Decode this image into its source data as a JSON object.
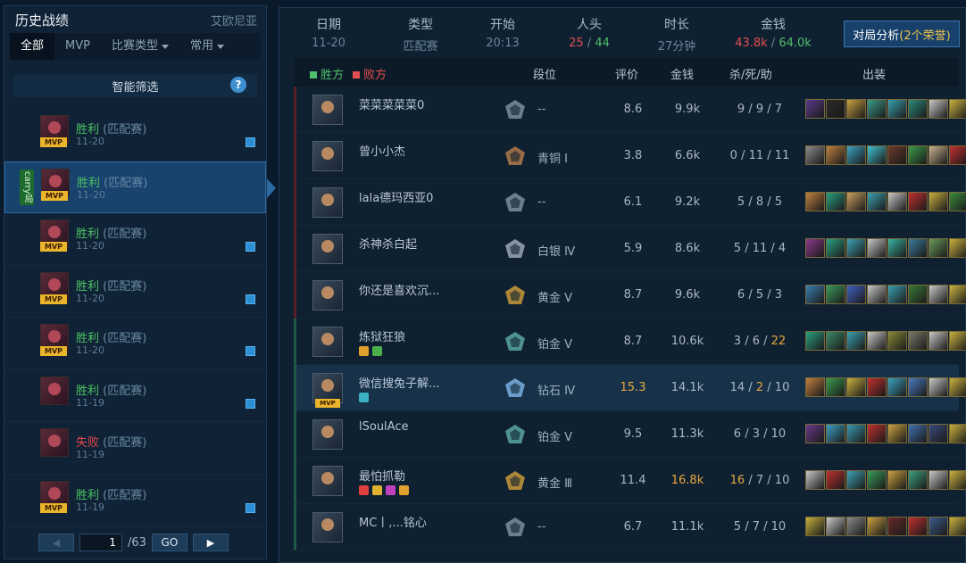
{
  "left": {
    "title": "历史战绩",
    "server": "艾欧尼亚",
    "tabs": [
      {
        "label": "全部",
        "active": true,
        "has_caret": false
      },
      {
        "label": "MVP",
        "active": false,
        "has_caret": false
      },
      {
        "label": "比赛类型",
        "active": false,
        "has_caret": true
      },
      {
        "label": "常用",
        "active": false,
        "has_caret": true
      }
    ],
    "smart_filter": "智能筛选",
    "help": "?",
    "matches": [
      {
        "result": "胜利",
        "outcome": "win",
        "mode": "(匹配赛)",
        "date": "11-20",
        "mvp": "MVP",
        "tag": "",
        "selected": false,
        "flag": true
      },
      {
        "result": "胜利",
        "outcome": "win",
        "mode": "(匹配赛)",
        "date": "11-20",
        "mvp": "MVP",
        "tag": "carry局",
        "selected": true,
        "flag": false
      },
      {
        "result": "胜利",
        "outcome": "win",
        "mode": "(匹配赛)",
        "date": "11-20",
        "mvp": "MVP",
        "tag": "",
        "selected": false,
        "flag": true
      },
      {
        "result": "胜利",
        "outcome": "win",
        "mode": "(匹配赛)",
        "date": "11-20",
        "mvp": "MVP",
        "tag": "",
        "selected": false,
        "flag": true
      },
      {
        "result": "胜利",
        "outcome": "win",
        "mode": "(匹配赛)",
        "date": "11-20",
        "mvp": "MVP",
        "tag": "",
        "selected": false,
        "flag": true
      },
      {
        "result": "胜利",
        "outcome": "win",
        "mode": "(匹配赛)",
        "date": "11-19",
        "mvp": "",
        "tag": "",
        "selected": false,
        "flag": true
      },
      {
        "result": "失败",
        "outcome": "lose",
        "mode": "(匹配赛)",
        "date": "11-19",
        "mvp": "",
        "tag": "",
        "selected": false,
        "flag": false
      },
      {
        "result": "胜利",
        "outcome": "win",
        "mode": "(匹配赛)",
        "date": "11-19",
        "mvp": "MVP",
        "tag": "",
        "selected": false,
        "flag": true
      }
    ],
    "pager": {
      "current": "1",
      "total": "/63",
      "go": "GO"
    }
  },
  "summary": {
    "date": {
      "label": "日期",
      "value": "11-20"
    },
    "type": {
      "label": "类型",
      "value": "匹配赛"
    },
    "start": {
      "label": "开始",
      "value": "20:13"
    },
    "kills": {
      "label": "人头",
      "red": "25",
      "sep": " / ",
      "green": "44"
    },
    "duration": {
      "label": "时长",
      "value": "27分钟"
    },
    "gold": {
      "label": "金钱",
      "red": "43.8k",
      "sep": " / ",
      "green": "64.0k"
    },
    "analyze": {
      "label": "对局分析",
      "count": "(2个荣誉)"
    }
  },
  "table": {
    "legend": {
      "win": "胜方",
      "lose": "败方"
    },
    "headers": {
      "rank": "段位",
      "score": "评价",
      "gold": "金钱",
      "kda": "杀/死/助",
      "items": "出装"
    },
    "rows": [
      {
        "team": "win",
        "name": "菜菜菜菜菜0",
        "rank": "--",
        "rank_color": "#7c8f9f",
        "score": "8.6",
        "gold": "9.9k",
        "k": "9",
        "d": "9",
        "a": "7",
        "mvp": "",
        "highlight": false,
        "badges": [],
        "items": [
          "#5a3a8a",
          "#2a2a2a",
          "#c8a040",
          "#3a9a8a",
          "#3aa0b0",
          "#2a8a7a",
          "#c8c8c8",
          "#c8b040"
        ],
        "gold_hi": false,
        "score_hi": false,
        "a_hi": false,
        "d_hi": false,
        "k_hi": false
      },
      {
        "team": "win",
        "name": "曾小小杰",
        "rank": "青铜 Ⅰ",
        "rank_color": "#b07a4a",
        "score": "3.8",
        "gold": "6.6k",
        "k": "0",
        "d": "11",
        "a": "11",
        "mvp": "",
        "highlight": false,
        "badges": [],
        "items": [
          "#8a8a8a",
          "#c08040",
          "#3aa0c0",
          "#40c0d0",
          "#6a3a2a",
          "#3a9a4a",
          "#c8b090",
          "#c03030"
        ],
        "gold_hi": false,
        "score_hi": false,
        "a_hi": false,
        "d_hi": false,
        "k_hi": false
      },
      {
        "team": "win",
        "name": "lala德玛西亚0",
        "rank": "--",
        "rank_color": "#7c8f9f",
        "score": "6.1",
        "gold": "9.2k",
        "k": "5",
        "d": "8",
        "a": "5",
        "mvp": "",
        "highlight": false,
        "badges": [],
        "items": [
          "#c08040",
          "#2aa080",
          "#c8a060",
          "#3aa0b0",
          "#c8c8c8",
          "#c03030",
          "#c8b040",
          "#3a8a3a"
        ],
        "gold_hi": false,
        "score_hi": false,
        "a_hi": false,
        "d_hi": false,
        "k_hi": false
      },
      {
        "team": "win",
        "name": "杀神杀白起",
        "rank": "白银 Ⅳ",
        "rank_color": "#9aa8b6",
        "score": "5.9",
        "gold": "8.6k",
        "k": "5",
        "d": "11",
        "a": "4",
        "mvp": "",
        "highlight": false,
        "badges": [],
        "items": [
          "#8a3a8a",
          "#2aa080",
          "#3aa0b0",
          "#c8c8c8",
          "#3ab0a0",
          "#3a7a9a",
          "#6a9a5a",
          "#c8b040"
        ],
        "gold_hi": false,
        "score_hi": false,
        "a_hi": false,
        "d_hi": false,
        "k_hi": false
      },
      {
        "team": "win",
        "name": "你还是喜欢沉...",
        "rank": "黄金 Ⅴ",
        "rank_color": "#c89a3a",
        "score": "8.7",
        "gold": "9.6k",
        "k": "6",
        "d": "5",
        "a": "3",
        "mvp": "",
        "highlight": false,
        "badges": [],
        "items": [
          "#3a80b0",
          "#3a9a5a",
          "#4060c0",
          "#c8c8c8",
          "#3aa0b0",
          "#3a7a3a",
          "#c8c8c8",
          "#c8b040"
        ],
        "gold_hi": false,
        "score_hi": false,
        "a_hi": false,
        "d_hi": false,
        "k_hi": false
      },
      {
        "team": "lose",
        "name": "炼狱狂狼",
        "rank": "铂金 Ⅴ",
        "rank_color": "#5aa8a0",
        "score": "8.7",
        "gold": "10.6k",
        "k": "3",
        "d": "6",
        "a": "22",
        "mvp": "",
        "highlight": false,
        "badges": [
          "#e0a030",
          "#4ab04a"
        ],
        "items": [
          "#2aa080",
          "#3a8a6a",
          "#3aa0b0",
          "#c8c8c8",
          "#8a8a3a",
          "#7a7a6a",
          "#c8c8c8",
          "#c8b040"
        ],
        "gold_hi": false,
        "score_hi": false,
        "a_hi": true,
        "d_hi": false,
        "k_hi": false
      },
      {
        "team": "lose",
        "name": "微信搜兔子解...",
        "rank": "钻石 Ⅳ",
        "rank_color": "#7ab0e0",
        "score": "15.3",
        "gold": "14.1k",
        "k": "14",
        "d": "2",
        "a": "10",
        "mvp": "MVP",
        "highlight": true,
        "badges": [
          "#3ab0c0"
        ],
        "items": [
          "#c08040",
          "#3a9a4a",
          "#c8b040",
          "#c03030",
          "#3aa0c0",
          "#4a7ac0",
          "#c8c8c8",
          "#c8b040"
        ],
        "gold_hi": false,
        "score_hi": true,
        "a_hi": false,
        "d_hi": true,
        "k_hi": false
      },
      {
        "team": "lose",
        "name": "lSoulAce",
        "rank": "铂金 Ⅴ",
        "rank_color": "#5aa8a0",
        "score": "9.5",
        "gold": "11.3k",
        "k": "6",
        "d": "3",
        "a": "10",
        "mvp": "",
        "highlight": false,
        "badges": [],
        "items": [
          "#6a3a8a",
          "#3aa0c0",
          "#3a9ab0",
          "#c03030",
          "#c8a040",
          "#4070b0",
          "#3a4a7a",
          "#c8b040"
        ],
        "gold_hi": false,
        "score_hi": false,
        "a_hi": false,
        "d_hi": false,
        "k_hi": false
      },
      {
        "team": "lose",
        "name": "最怕抓勒",
        "rank": "黄金 Ⅲ",
        "rank_color": "#c89a3a",
        "score": "11.4",
        "gold": "16.8k",
        "k": "16",
        "d": "7",
        "a": "10",
        "mvp": "",
        "highlight": false,
        "badges": [
          "#e04040",
          "#e0b030",
          "#c040c0",
          "#e0a030"
        ],
        "items": [
          "#c8c8c8",
          "#c03030",
          "#3aa0b0",
          "#3a9a5a",
          "#c8a040",
          "#3aa080",
          "#c8c8c8",
          "#c8b040"
        ],
        "gold_hi": true,
        "score_hi": false,
        "a_hi": false,
        "d_hi": false,
        "k_hi": true
      },
      {
        "team": "lose",
        "name": "MC丨,...铭心",
        "rank": "--",
        "rank_color": "#7c8f9f",
        "score": "6.7",
        "gold": "11.1k",
        "k": "5",
        "d": "7",
        "a": "10",
        "mvp": "",
        "highlight": false,
        "badges": [],
        "items": [
          "#c8b040",
          "#c8c8c8",
          "#8a8a8a",
          "#c8a040",
          "#6a2a2a",
          "#c03030",
          "#3a5a8a",
          "#c8b040"
        ],
        "gold_hi": false,
        "score_hi": false,
        "a_hi": false,
        "d_hi": false,
        "k_hi": false
      }
    ]
  }
}
